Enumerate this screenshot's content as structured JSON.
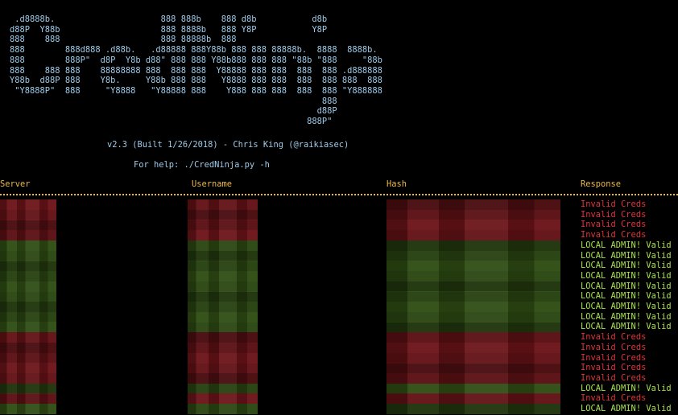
{
  "banner": {
    "ascii_art": " .d8888b.                     888 888b    888 d8b           d8b\nd88P  Y88b                    888 8888b   888 Y8P           Y8P\n888    888                    888 88888b  888\n888        888d888 .d88b.   .d88888 888Y88b 888 888 88888b.  8888  8888b.\n888        888P\"  d8P  Y8b d88\" 888 888 Y88b888 888 888 \"88b \"888     \"88b\n888    888 888    88888888 888  888 888  Y88888 888 888  888  888 .d888888\nY88b  d88P 888    Y8b.     Y88b 888 888   Y8888 888 888  888  888 888  888\n \"Y8888P\"  888     \"Y8888   \"Y88888 888    Y888 888 888  888  888 \"Y888888\n                                                              888\n                                                             d88P\n                                                           888P\"",
    "version_line": "v2.3 (Built 1/26/2018) - Chris King (@raikiasec)",
    "help_line": "For help: ./CredNinja.py -h"
  },
  "columns": {
    "server": "Server",
    "username": "Username",
    "hash": "Hash",
    "response": "Response"
  },
  "rows": [
    {
      "response": "Invalid Creds",
      "status": "invalid"
    },
    {
      "response": "Invalid Creds",
      "status": "invalid"
    },
    {
      "response": "Invalid Creds",
      "status": "invalid"
    },
    {
      "response": "Invalid Creds",
      "status": "invalid"
    },
    {
      "response": "LOCAL ADMIN! Valid",
      "status": "admin"
    },
    {
      "response": "LOCAL ADMIN! Valid",
      "status": "admin"
    },
    {
      "response": "LOCAL ADMIN! Valid",
      "status": "admin"
    },
    {
      "response": "LOCAL ADMIN! Valid",
      "status": "admin"
    },
    {
      "response": "LOCAL ADMIN! Valid",
      "status": "admin"
    },
    {
      "response": "LOCAL ADMIN! Valid",
      "status": "admin"
    },
    {
      "response": "LOCAL ADMIN! Valid",
      "status": "admin"
    },
    {
      "response": "LOCAL ADMIN! Valid",
      "status": "admin"
    },
    {
      "response": "LOCAL ADMIN! Valid",
      "status": "admin"
    },
    {
      "response": "Invalid Creds",
      "status": "invalid"
    },
    {
      "response": "Invalid Creds",
      "status": "invalid"
    },
    {
      "response": "Invalid Creds",
      "status": "invalid"
    },
    {
      "response": "Invalid Creds",
      "status": "invalid"
    },
    {
      "response": "Invalid Creds",
      "status": "invalid"
    },
    {
      "response": "LOCAL ADMIN! Valid",
      "status": "admin"
    },
    {
      "response": "Invalid Creds",
      "status": "invalid"
    },
    {
      "response": "LOCAL ADMIN! Valid",
      "status": "admin"
    }
  ],
  "colors": {
    "background": "#000000",
    "banner_text": "#9ecbea",
    "header_text": "#e8b84a",
    "invalid_text": "#e0343a",
    "admin_text": "#a9e34a",
    "invalid_blur": "#6b1418",
    "admin_blur": "#2f4d14"
  }
}
